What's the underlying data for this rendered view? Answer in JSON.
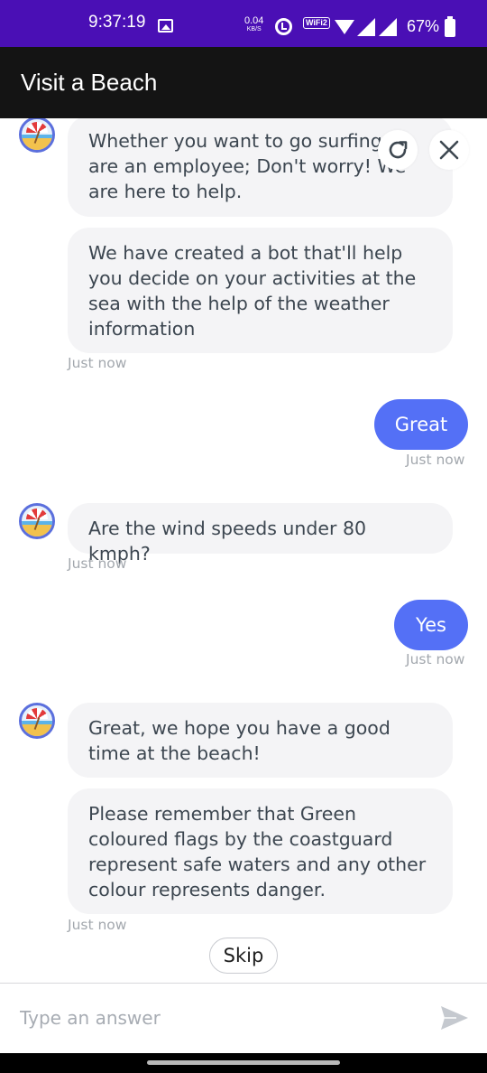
{
  "status_bar": {
    "time": "9:37:19",
    "net_speed": "0.04",
    "net_unit": "KB/S",
    "wifi_badge": "Vo→ WiFi 2",
    "wifi_badge_short": "WiFi2",
    "battery": "67%",
    "bg_color": "#4a0fb5"
  },
  "app_bar": {
    "title": "Visit a Beach",
    "bg_color": "#141414"
  },
  "chat": {
    "messages": [
      {
        "sender": "bot",
        "text": "Whether you want to go surfing or are an employee; Don't worry! We are here to help."
      },
      {
        "sender": "bot",
        "text": "We have created a bot that'll help you decide on your activities at the sea with the help of the weather information"
      },
      {
        "sender": "bot_time",
        "text": "Just now"
      },
      {
        "sender": "user",
        "text": "Great"
      },
      {
        "sender": "user_time",
        "text": "Just now"
      },
      {
        "sender": "bot",
        "text": "Are the wind speeds under 80 kmph?"
      },
      {
        "sender": "bot_time",
        "text": "Just now"
      },
      {
        "sender": "user",
        "text": "Yes"
      },
      {
        "sender": "user_time",
        "text": "Just now"
      },
      {
        "sender": "bot",
        "text": "Great, we hope you have a good time at the beach!"
      },
      {
        "sender": "bot",
        "text": "Please remember that Green coloured flags by the coastguard represent safe waters and any other colour represents danger."
      },
      {
        "sender": "bot_time",
        "text": "Just now"
      }
    ],
    "user_bubble_color": "#5470f6",
    "bot_bubble_color": "#f4f4f6",
    "skip_label": "Skip"
  },
  "input": {
    "placeholder": "Type an answer",
    "value": ""
  },
  "icons": {
    "refresh": "refresh-icon",
    "close": "close-icon",
    "send": "send-icon",
    "avatar": "beach-umbrella-avatar"
  }
}
